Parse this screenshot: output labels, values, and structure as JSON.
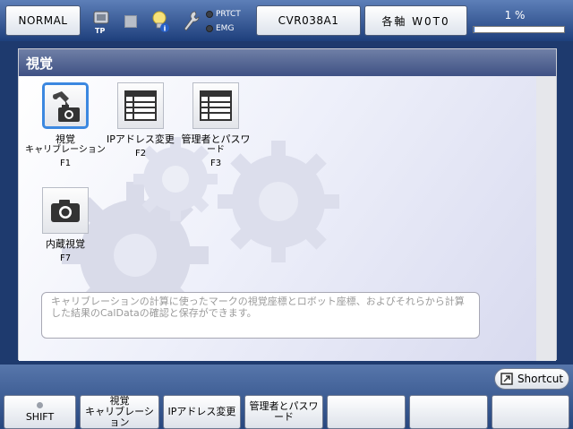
{
  "topbar": {
    "mode": "NORMAL",
    "tp_label": "TP",
    "prtct_label": "PRTCT",
    "emg_label": "EMG",
    "program": "CVR038A1",
    "axis": "各軸 W0T0",
    "override": "1 %",
    "override_fraction": 0.01
  },
  "window": {
    "title": "視覚",
    "items": [
      {
        "label": "視覚",
        "sub": "キャリブレーション",
        "key": "F1",
        "icon": "robot-camera-icon",
        "selected": true
      },
      {
        "label": "IPアドレス変更",
        "sub": "",
        "key": "F2",
        "icon": "table-icon",
        "selected": false
      },
      {
        "label": "管理者とパスワ",
        "sub": "ード",
        "key": "F3",
        "icon": "table-icon",
        "selected": false
      },
      {
        "label": "内蔵視覚",
        "sub": "",
        "key": "F7",
        "icon": "camera-icon",
        "selected": false
      }
    ],
    "description": "キャリブレーションの計算に使ったマークの視覚座標とロボット座標、およびそれらから計算した結果のCalDataの確認と保存ができます。"
  },
  "bottombar": {
    "shortcut_label": "Shortcut",
    "fkeys": [
      {
        "line1": "SHIFT",
        "line2": ""
      },
      {
        "line1": "視覚",
        "line2": "キャリブレーション"
      },
      {
        "line1": "IPアドレス変更",
        "line2": ""
      },
      {
        "line1": "管理者とパスワ",
        "line2": "ード"
      },
      {
        "line1": "",
        "line2": ""
      },
      {
        "line1": "",
        "line2": ""
      },
      {
        "line1": "",
        "line2": ""
      }
    ]
  },
  "colors": {
    "selection": "#3c88e0",
    "title_bar": "#3f5184",
    "progress": "#2b6bd0"
  }
}
